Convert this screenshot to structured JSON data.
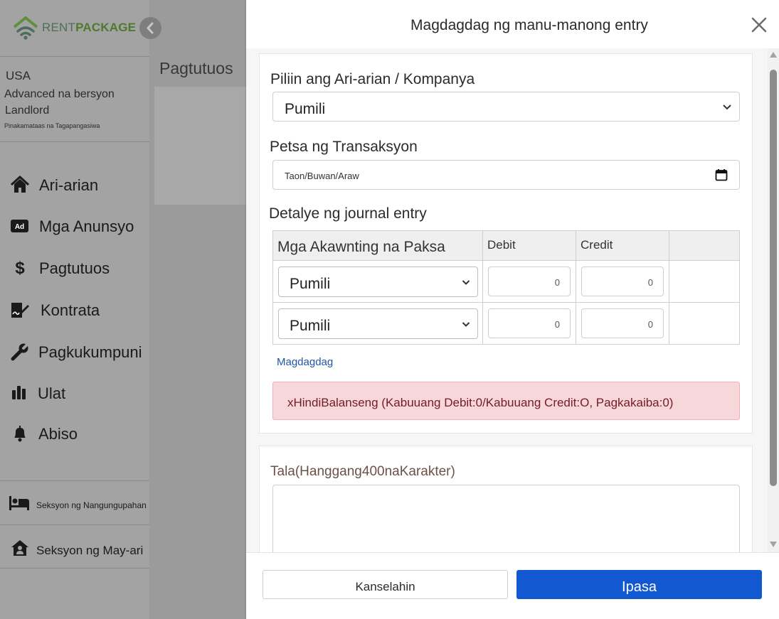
{
  "brand": {
    "part1": "RENT",
    "part2": "PACKAGE"
  },
  "user": {
    "country": "USA",
    "plan": "Advanced na bersyon",
    "role": "Landlord",
    "subrole": "Pinakamataas na Tagapangasiwa"
  },
  "sidebar": {
    "items": [
      {
        "label": "Ari-arian",
        "icon": "home-icon"
      },
      {
        "label": "Mga Anunsyo",
        "icon": "ad-icon"
      },
      {
        "label": "Pagtutuos",
        "icon": "dollar-icon"
      },
      {
        "label": "Kontrata",
        "icon": "contract-icon"
      },
      {
        "label": "Pagkukumpuni",
        "icon": "wrench-icon"
      },
      {
        "label": "Ulat",
        "icon": "bar-chart-icon"
      },
      {
        "label": "Abiso",
        "icon": "bell-icon"
      }
    ],
    "sections": [
      {
        "label": "Seksyon ng Nangungupahan",
        "icon": "bed-icon"
      },
      {
        "label": "Seksyon ng May-ari",
        "icon": "house-user-icon"
      }
    ]
  },
  "page": {
    "title": "Pagtutuos"
  },
  "modal": {
    "title": "Magdagdag ng manu-manong entry",
    "property_label": "Piliin ang Ari-arian / Kompanya",
    "property_value": "Pumili",
    "date_label": "Petsa ng Transaksyon",
    "date_placeholder": "Taon/Buwan/Araw",
    "journal_label": "Detalye ng journal entry",
    "table": {
      "headers": [
        "Mga Akawnting na Paksa",
        "Debit",
        "Credit",
        ""
      ],
      "rows": [
        {
          "account": "Pumili",
          "debit": "0",
          "credit": "0"
        },
        {
          "account": "Pumili",
          "debit": "0",
          "credit": "0"
        }
      ]
    },
    "add_link": "Magdagdag",
    "alert": "xHindiBalanseng (Kabuuang Debit:0/Kabuuang Credit:O, Pagkakaiba:0)",
    "note_label": "Tala(Hanggang400naKarakter)",
    "note_value": "",
    "cancel": "Kanselahin",
    "submit": "Ipasa"
  },
  "colors": {
    "brand_green": "#4f7a2e",
    "submit_blue": "#1258d1",
    "alert_bg": "#f8d7da",
    "alert_text": "#721c24",
    "link_blue": "#1f56a8"
  }
}
